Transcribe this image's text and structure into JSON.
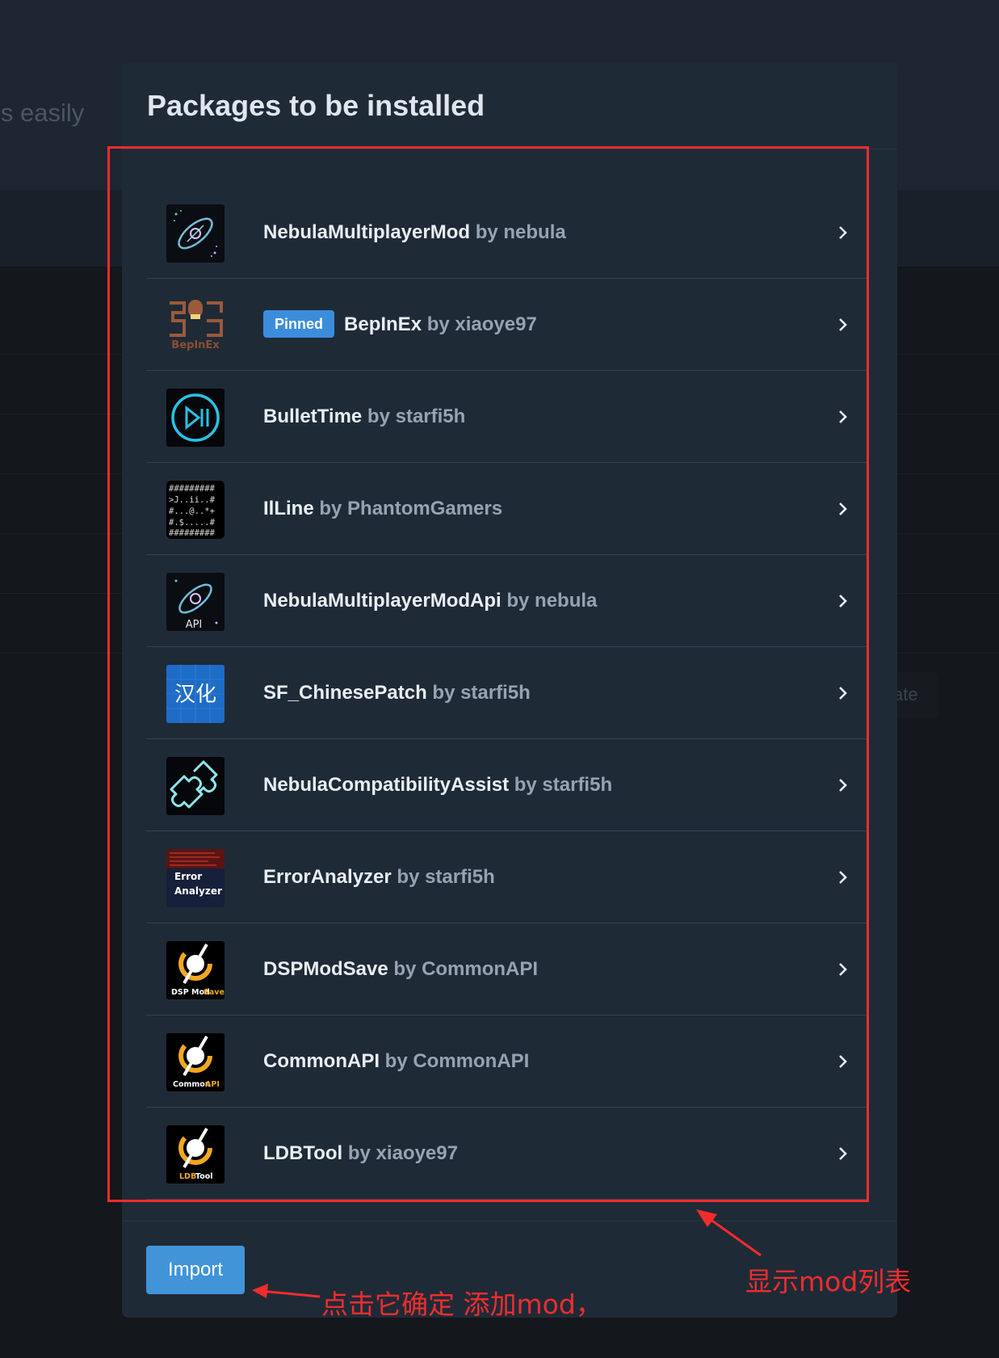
{
  "background": {
    "tagline_fragment": "ls easily",
    "button_fragment": "ate"
  },
  "modal": {
    "title": "Packages to be installed",
    "import_label": "Import",
    "packages": [
      {
        "name": "NebulaMultiplayerMod",
        "by": "by nebula",
        "icon": "nebula-icon",
        "pinned": false
      },
      {
        "name": "BepInEx",
        "by": "by xiaoye97",
        "icon": "bepinex-icon",
        "pinned": true,
        "badge": "Pinned"
      },
      {
        "name": "BulletTime",
        "by": "by starfi5h",
        "icon": "play-pause-icon",
        "pinned": false
      },
      {
        "name": "IlLine",
        "by": "by PhantomGamers",
        "icon": "ascii-map-icon",
        "pinned": false
      },
      {
        "name": "NebulaMultiplayerModApi",
        "by": "by nebula",
        "icon": "nebula-api-icon",
        "pinned": false
      },
      {
        "name": "SF_ChinesePatch",
        "by": "by starfi5h",
        "icon": "chinese-patch-icon",
        "pinned": false
      },
      {
        "name": "NebulaCompatibilityAssist",
        "by": "by starfi5h",
        "icon": "puzzle-icon",
        "pinned": false
      },
      {
        "name": "ErrorAnalyzer",
        "by": "by starfi5h",
        "icon": "error-analyzer-icon",
        "pinned": false
      },
      {
        "name": "DSPModSave",
        "by": "by CommonAPI",
        "icon": "dsp-mod-save-icon",
        "pinned": false
      },
      {
        "name": "CommonAPI",
        "by": "by CommonAPI",
        "icon": "common-api-icon",
        "pinned": false
      },
      {
        "name": "LDBTool",
        "by": "by xiaoye97",
        "icon": "ldb-tool-icon",
        "pinned": false
      }
    ],
    "icon_texts": {
      "bepinex": "BepInEx",
      "api": "API",
      "chinese": "汉化",
      "error": "Error",
      "analyzer": "Analyzer",
      "dsp_mod": "DSP Mod",
      "save": "Save",
      "common": "Common",
      "api2": "API",
      "ldb": "LDB",
      "tool": "Tool",
      "ascii": [
        "#########",
        ">J..ii..#",
        "#...@..*+",
        "#.$.....#",
        "#########"
      ]
    }
  },
  "annotations": {
    "list_label": "显示mod列表",
    "button_label": "点击它确定 添加mod，"
  },
  "colors": {
    "accent": "#3b8ddb",
    "annotation": "#f02d2d",
    "modal_bg": "#1f2a37"
  }
}
